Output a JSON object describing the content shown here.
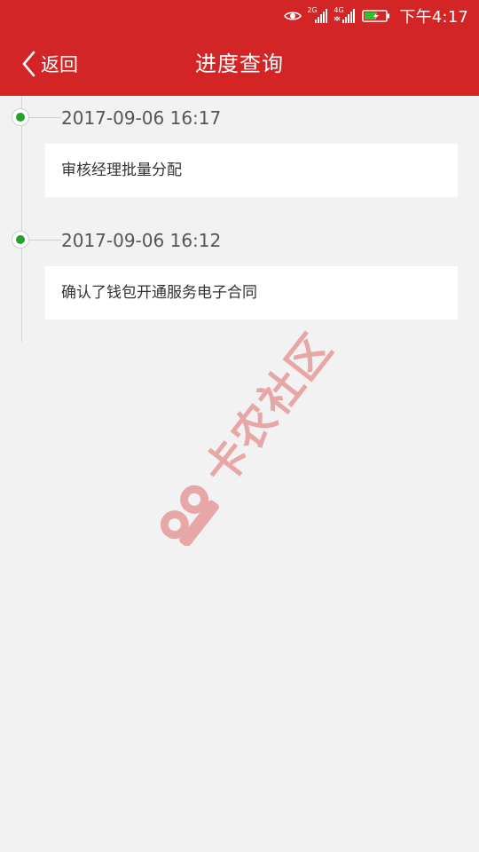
{
  "status_bar": {
    "time": "下午4:17",
    "network_1": "2G",
    "network_2": "4G",
    "icons": [
      "eye-icon",
      "signal-2g-icon",
      "signal-4g-icon",
      "battery-icon"
    ]
  },
  "header": {
    "back_label": "返回",
    "title": "进度查询"
  },
  "timeline": {
    "items": [
      {
        "time": "2017-09-06 16:17",
        "description": "审核经理批量分配"
      },
      {
        "time": "2017-09-06 16:12",
        "description": "确认了钱包开通服务电子合同"
      }
    ]
  },
  "watermark": {
    "text": "卡农社区"
  },
  "colors": {
    "brand_red": "#d32526",
    "node_green": "#22a32b",
    "background": "#f2f2f3"
  }
}
